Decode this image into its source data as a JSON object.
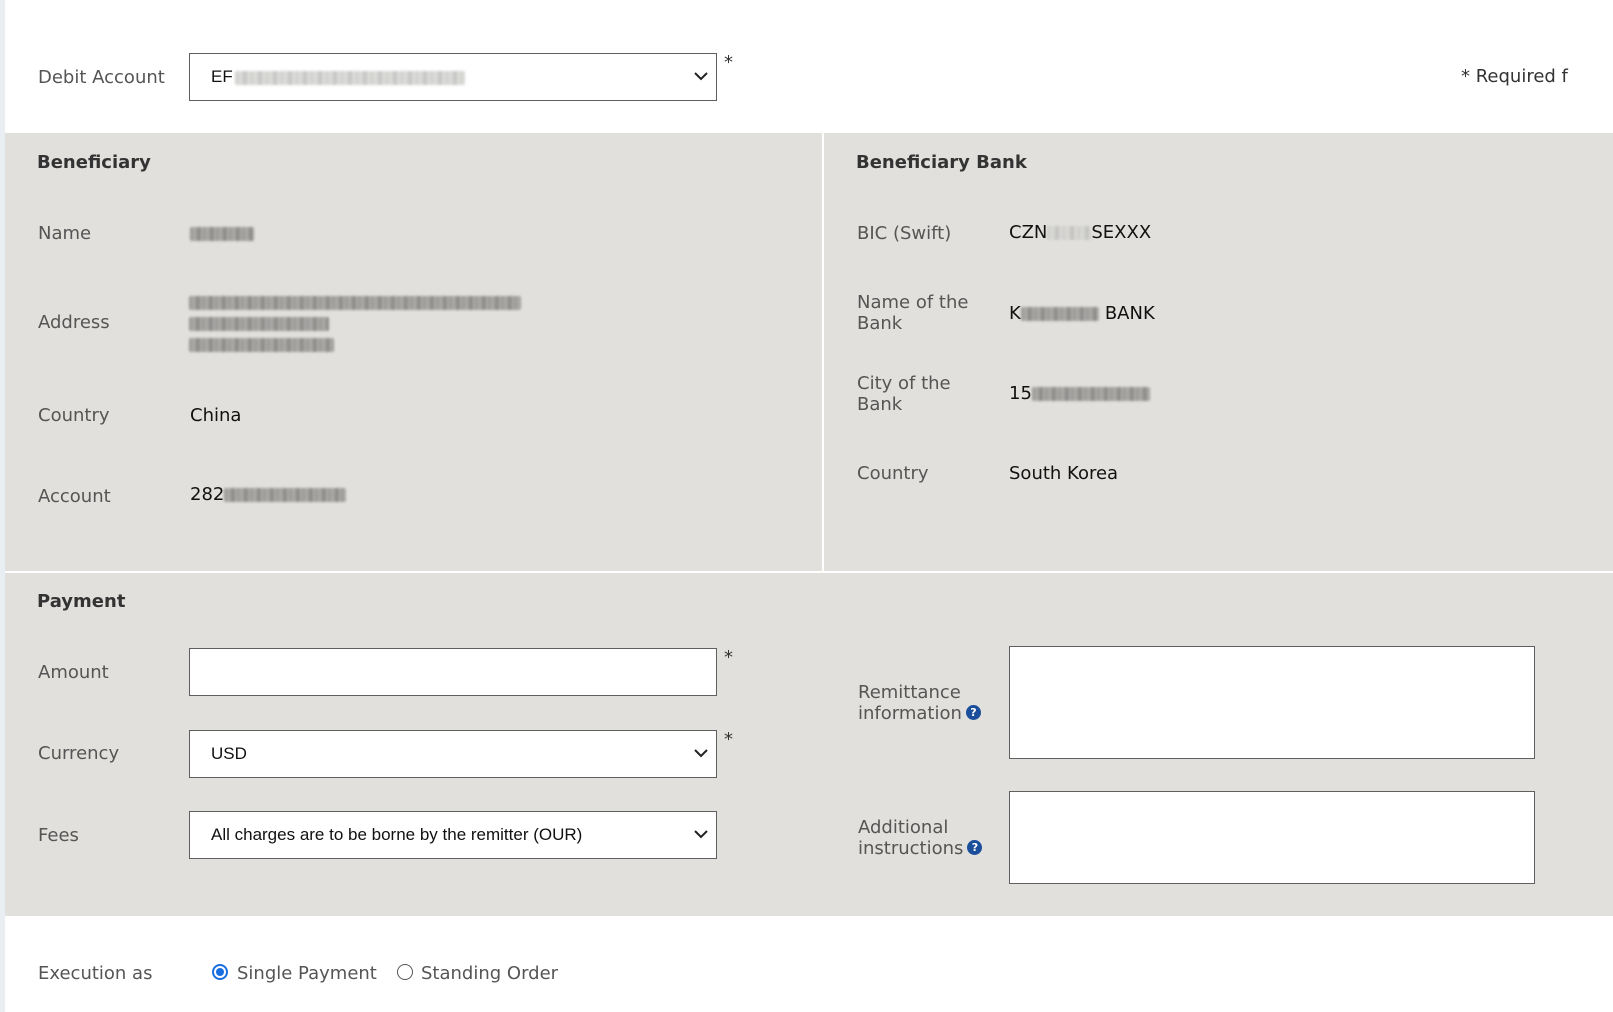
{
  "header": {
    "debit_account_label": "Debit Account",
    "debit_account_value": "EF",
    "required_note": "* Required f"
  },
  "beneficiary": {
    "title": "Beneficiary",
    "name_label": "Name",
    "address_label": "Address",
    "country_label": "Country",
    "country_value": "China",
    "account_label": "Account",
    "account_value": "282"
  },
  "beneficiary_bank": {
    "title": "Beneficiary Bank",
    "bic_label": "BIC (Swift)",
    "bic_prefix": "CZN",
    "bic_suffix": "SEXXX",
    "bank_name_label_1": "Name of the",
    "bank_name_label_2": "Bank",
    "bank_name_prefix": "K",
    "bank_name_suffix": "BANK",
    "city_label_1": "City of the",
    "city_label_2": "Bank",
    "city_prefix": "15",
    "country_label": "Country",
    "country_value": "South Korea"
  },
  "payment": {
    "title": "Payment",
    "amount_label": "Amount",
    "amount_value": "",
    "currency_label": "Currency",
    "currency_value": "USD",
    "fees_label": "Fees",
    "fees_value": "All charges are to be borne by the remitter (OUR)",
    "remittance_label_1": "Remittance",
    "remittance_label_2": "information",
    "additional_label_1": "Additional",
    "additional_label_2": "instructions",
    "info_icon_glyph": "?"
  },
  "execution": {
    "label": "Execution as",
    "options": [
      {
        "label": "Single Payment",
        "selected": true
      },
      {
        "label": "Standing Order",
        "selected": false
      }
    ]
  },
  "required_marker": "*",
  "colors": {
    "panel_bg": "#e1e0dd",
    "radio_accent": "#1a6fe0",
    "info_icon": "#1b4f9c"
  }
}
